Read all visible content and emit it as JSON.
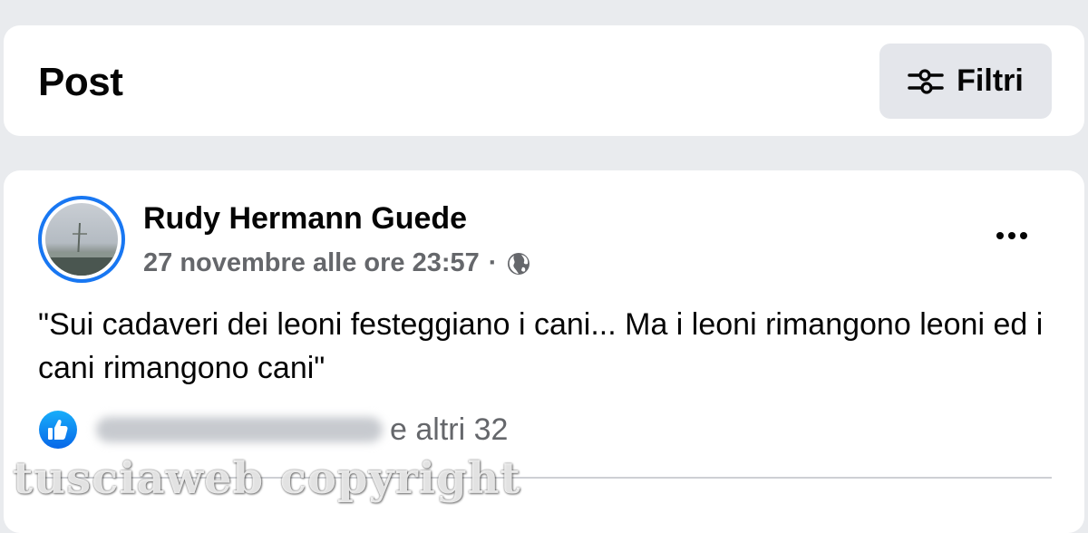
{
  "header": {
    "title": "Post",
    "filter_label": "Filtri"
  },
  "post": {
    "author": "Rudy Hermann Guede",
    "date": "27 novembre alle ore 23:57",
    "separator": "·",
    "text": "\"Sui cadaveri dei leoni festeggiano i cani... Ma i leoni rimangono leoni ed i cani rimangono cani\"",
    "reactions_others": "e altri 32"
  },
  "watermark": "tusciaweb copyright",
  "colors": {
    "background": "#e9ebee",
    "card": "#ffffff",
    "button_bg": "#e4e6eb",
    "accent_blue": "#1877f2",
    "secondary_text": "#65676b"
  },
  "icons": {
    "filter": "sliders-icon",
    "privacy": "globe-icon",
    "more": "more-horizontal-icon",
    "reaction": "like-icon"
  }
}
